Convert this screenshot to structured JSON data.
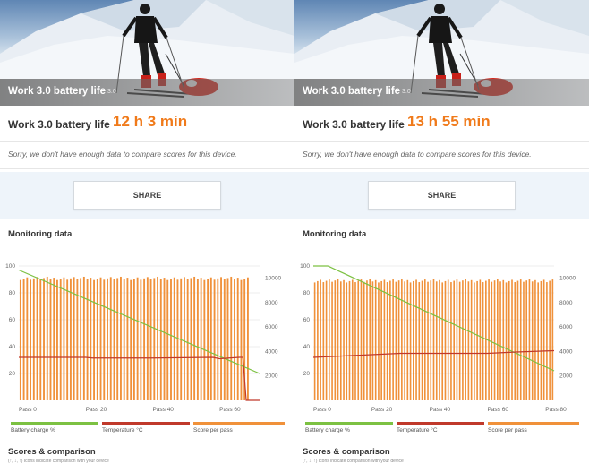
{
  "colors": {
    "accent": "#f07a1a",
    "battery": "#7cc142",
    "temperature": "#c0392b",
    "score": "#f0913a"
  },
  "panels": [
    {
      "hero_title": "Work 3.0 battery life",
      "hero_version": "3.0",
      "score_label": "Work 3.0 battery life",
      "score_value": "12 h 3 min",
      "sorry_text": "Sorry, we don't have enough data to compare scores for this device.",
      "share_label": "SHARE",
      "monitoring_title": "Monitoring data",
      "scores_title": "Scores & comparison",
      "scores_sub": "(↑, ↓, ↑) Icons indicate comparison with your device",
      "legend": [
        "Battery charge %",
        "Temperature °C",
        "Score per pass"
      ],
      "chart_data": {
        "type": "bar",
        "x_tick_labels": [
          "Pass 0",
          "Pass 20",
          "Pass 40",
          "Pass 60"
        ],
        "x_tick_values": [
          0,
          20,
          40,
          60
        ],
        "left_axis_ticks": [
          "20",
          "40",
          "60",
          "80",
          "100"
        ],
        "left_axis_values": [
          20,
          40,
          60,
          80,
          100
        ],
        "left_axis_range": [
          0,
          100
        ],
        "right_axis_ticks": [
          "2000",
          "4000",
          "6000",
          "8000",
          "10000"
        ],
        "right_axis_values": [
          2000,
          4000,
          6000,
          8000,
          10000
        ],
        "right_axis_range": [
          0,
          11000
        ],
        "pass_count": 72,
        "series": [
          {
            "name": "Score per pass",
            "axis": "right",
            "base_value": 10000,
            "bars_end_pass": 69
          },
          {
            "name": "Battery charge %",
            "axis": "left",
            "points": [
              [
                0,
                97
              ],
              [
                72,
                20
              ]
            ]
          },
          {
            "name": "Temperature °C",
            "axis": "left",
            "points": [
              [
                0,
                32
              ],
              [
                20,
                32
              ],
              [
                22,
                31.5
              ],
              [
                40,
                31.5
              ],
              [
                58,
                32
              ],
              [
                60,
                31
              ],
              [
                66,
                32
              ],
              [
                67,
                32
              ],
              [
                68,
                0
              ],
              [
                72,
                0
              ]
            ]
          }
        ]
      }
    },
    {
      "hero_title": "Work 3.0 battery life",
      "hero_version": "3.0",
      "score_label": "Work 3.0 battery life",
      "score_value": "13 h 55 min",
      "sorry_text": "Sorry, we don't have enough data to compare scores for this device.",
      "share_label": "SHARE",
      "monitoring_title": "Monitoring data",
      "scores_title": "Scores & comparison",
      "scores_sub": "(↑, ↓, ↑) Icons indicate comparison with your device",
      "legend": [
        "Battery charge %",
        "Temperature °C",
        "Score per pass"
      ],
      "chart_data": {
        "type": "bar",
        "x_tick_labels": [
          "Pass 0",
          "Pass 20",
          "Pass 40",
          "Pass 60",
          "Pass 80"
        ],
        "x_tick_values": [
          0,
          20,
          40,
          60,
          80
        ],
        "left_axis_ticks": [
          "20",
          "40",
          "60",
          "80",
          "100"
        ],
        "left_axis_values": [
          20,
          40,
          60,
          80,
          100
        ],
        "left_axis_range": [
          0,
          100
        ],
        "right_axis_ticks": [
          "2000",
          "4000",
          "6000",
          "8000",
          "10000"
        ],
        "right_axis_values": [
          2000,
          4000,
          6000,
          8000,
          10000
        ],
        "right_axis_range": [
          0,
          11000
        ],
        "pass_count": 83,
        "series": [
          {
            "name": "Score per pass",
            "axis": "right",
            "base_value": 9800,
            "bars_end_pass": 83
          },
          {
            "name": "Battery charge %",
            "axis": "left",
            "points": [
              [
                0,
                100
              ],
              [
                5,
                100
              ],
              [
                83,
                22
              ]
            ]
          },
          {
            "name": "Temperature °C",
            "axis": "left",
            "points": [
              [
                0,
                32
              ],
              [
                10,
                33
              ],
              [
                30,
                35
              ],
              [
                60,
                35
              ],
              [
                70,
                36
              ],
              [
                83,
                37
              ]
            ]
          }
        ]
      }
    }
  ]
}
